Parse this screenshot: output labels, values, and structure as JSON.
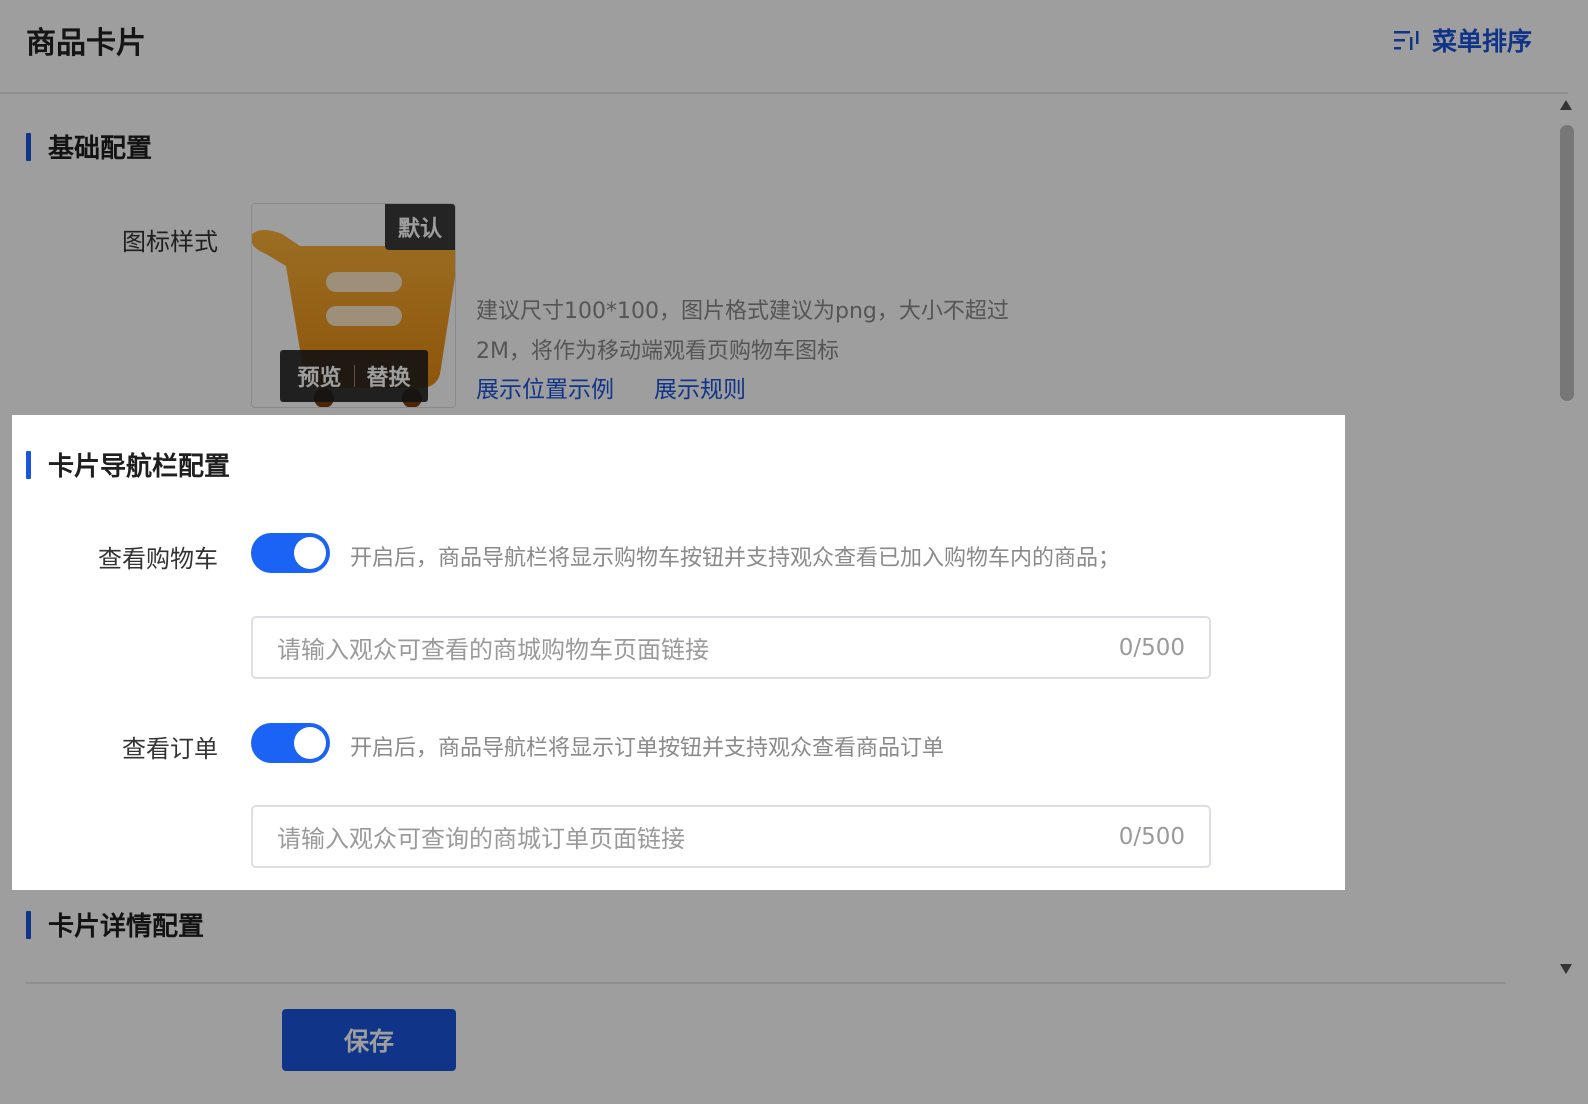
{
  "header": {
    "title": "商品卡片",
    "sort_label": "菜单排序"
  },
  "basic": {
    "section_title": "基础配置",
    "icon_label": "图标样式",
    "default_tag": "默认",
    "preview_label": "预览",
    "replace_label": "替换",
    "hint_line1": "建议尺寸100*100，图片格式建议为png，大小不超过",
    "hint_line2": "2M，将作为移动端观看页购物车图标",
    "link_example": "展示位置示例",
    "link_rules": "展示规则"
  },
  "nav": {
    "section_title": "卡片导航栏配置",
    "cart": {
      "label": "查看购物车",
      "enabled": true,
      "desc": "开启后，商品导航栏将显示购物车按钮并支持观众查看已加入购物车内的商品；",
      "placeholder": "请输入观众可查看的商城购物车页面链接",
      "counter": "0/500"
    },
    "order": {
      "label": "查看订单",
      "enabled": true,
      "desc": "开启后，商品导航栏将显示订单按钮并支持观众查看商品订单",
      "placeholder": "请输入观众可查询的商城订单页面链接",
      "counter": "0/500"
    }
  },
  "detail": {
    "section_title": "卡片详情配置"
  },
  "footer": {
    "save_label": "保存"
  },
  "colors": {
    "accent": "#1a56db",
    "toggle_on": "#1a63f5",
    "icon_orange": "#f5a524"
  }
}
